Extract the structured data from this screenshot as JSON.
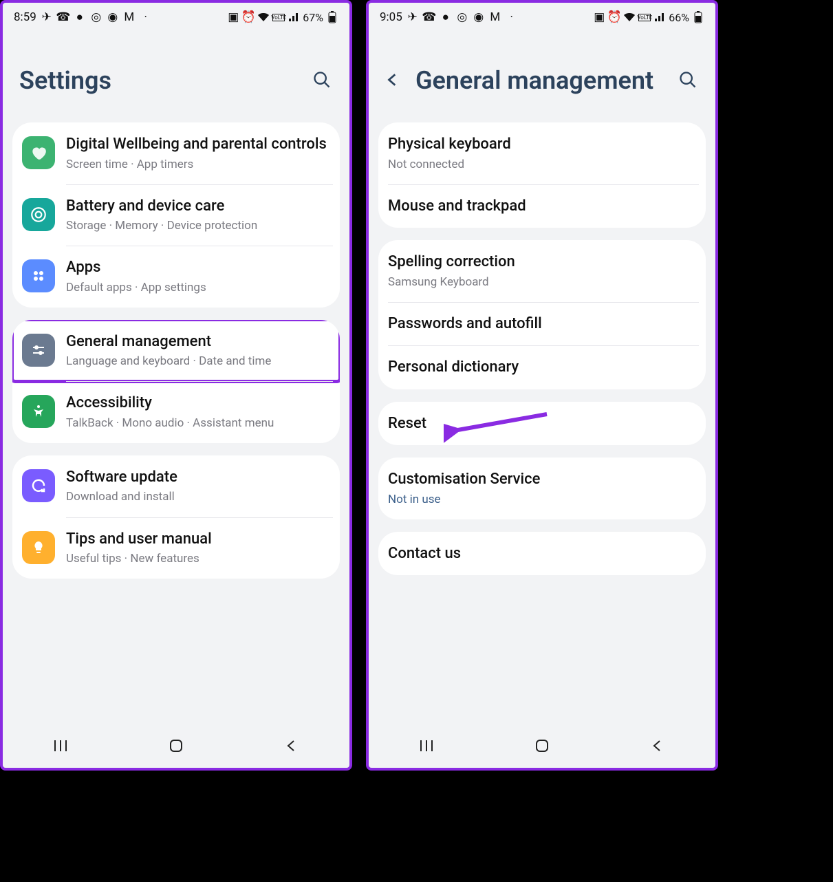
{
  "left": {
    "status": {
      "time": "8:59",
      "battery_pct": "67%"
    },
    "header": {
      "title": "Settings"
    },
    "groups": [
      {
        "rows": [
          {
            "icon": "heart",
            "color": "ic-green",
            "title": "Digital Wellbeing and parental controls",
            "sub": "Screen time  ·  App timers"
          },
          {
            "icon": "care",
            "color": "ic-teal",
            "title": "Battery and device care",
            "sub": "Storage  ·  Memory  ·  Device protection"
          },
          {
            "icon": "grid",
            "color": "ic-blue",
            "title": "Apps",
            "sub": "Default apps  ·  App settings"
          }
        ]
      },
      {
        "rows": [
          {
            "icon": "sliders",
            "color": "ic-slate",
            "title": "General management",
            "sub": "Language and keyboard  ·  Date and time",
            "highlight": true
          },
          {
            "icon": "a11y",
            "color": "ic-agreen",
            "title": "Accessibility",
            "sub": "TalkBack  ·  Mono audio  ·  Assistant menu"
          }
        ]
      },
      {
        "rows": [
          {
            "icon": "refresh",
            "color": "ic-purple",
            "title": "Software update",
            "sub": "Download and install"
          },
          {
            "icon": "bulb",
            "color": "ic-orange",
            "title": "Tips and user manual",
            "sub": "Useful tips  ·  New features"
          }
        ]
      }
    ]
  },
  "right": {
    "status": {
      "time": "9:05",
      "battery_pct": "66%"
    },
    "header": {
      "title": "General management",
      "back": true
    },
    "groups": [
      {
        "rows": [
          {
            "title": "Physical keyboard",
            "sub": "Not connected"
          },
          {
            "title": "Mouse and trackpad"
          }
        ]
      },
      {
        "rows": [
          {
            "title": "Spelling correction",
            "sub": "Samsung Keyboard"
          },
          {
            "title": "Passwords and autofill"
          },
          {
            "title": "Personal dictionary"
          }
        ]
      },
      {
        "rows": [
          {
            "title": "Reset",
            "arrow": true
          }
        ]
      },
      {
        "rows": [
          {
            "title": "Customisation Service",
            "sub": "Not in use",
            "sub_blue": true
          }
        ]
      },
      {
        "rows": [
          {
            "title": "Contact us"
          }
        ]
      }
    ]
  },
  "status_icons": [
    "telegram",
    "whatsapp",
    "chat",
    "instagram",
    "camera",
    "gmail",
    "dot"
  ],
  "status_right_icons": [
    "battery-saver",
    "alarm",
    "wifi",
    "volte",
    "signal"
  ]
}
